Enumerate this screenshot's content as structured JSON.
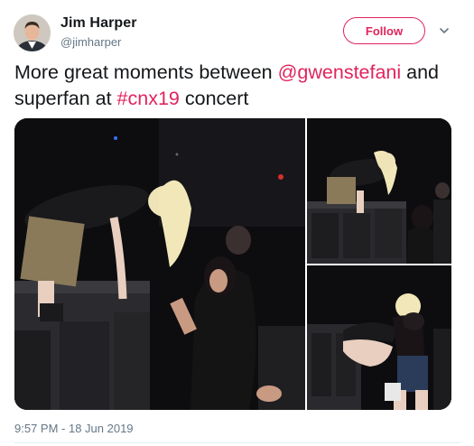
{
  "author": {
    "name": "Jim Harper",
    "handle": "@jimharper",
    "avatar_icon": "profile-photo"
  },
  "follow_button": {
    "label": "Follow",
    "color": "#e0245e"
  },
  "menu_icon": "chevron-down-icon",
  "tweet": {
    "text_1": "More great moments between ",
    "mention": "@gwenstefani",
    "text_2": " and superfan at ",
    "hashtag": "#cnx19",
    "text_3": " concert",
    "link_color": "#e0245e"
  },
  "photos": [
    {
      "description": "Performer leaning down from stage toward fan"
    },
    {
      "description": "Performer crouching at stage edge above crowd"
    },
    {
      "description": "Performer hugging fan at stage edge"
    }
  ],
  "timestamp": "9:57 PM - 18 Jun 2019"
}
